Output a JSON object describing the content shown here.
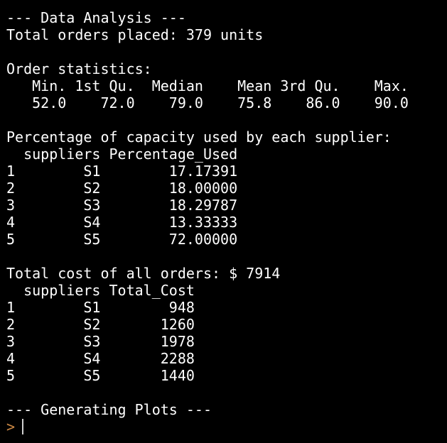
{
  "console": {
    "lines": [
      "--- Data Analysis ---",
      "Total orders placed: 379 units",
      "",
      "Order statistics:",
      "   Min. 1st Qu.  Median    Mean 3rd Qu.    Max. ",
      "   52.0    72.0    79.0    75.8    86.0    90.0 ",
      "",
      "Percentage of capacity used by each supplier:",
      "  suppliers Percentage_Used",
      "1        S1        17.17391",
      "2        S2        18.00000",
      "3        S3        18.29787",
      "4        S4        13.33333",
      "5        S5        72.00000",
      "",
      "Total cost of all orders: $ 7914",
      "  suppliers Total_Cost",
      "1        S1        948",
      "2        S2       1260",
      "3        S3       1978",
      "4        S4       2288",
      "5        S5       1440",
      "",
      "--- Generating Plots ---"
    ],
    "prompt": ">",
    "colors": {
      "background": "#000000",
      "text": "#ffffff",
      "prompt": "#cc8844"
    }
  }
}
